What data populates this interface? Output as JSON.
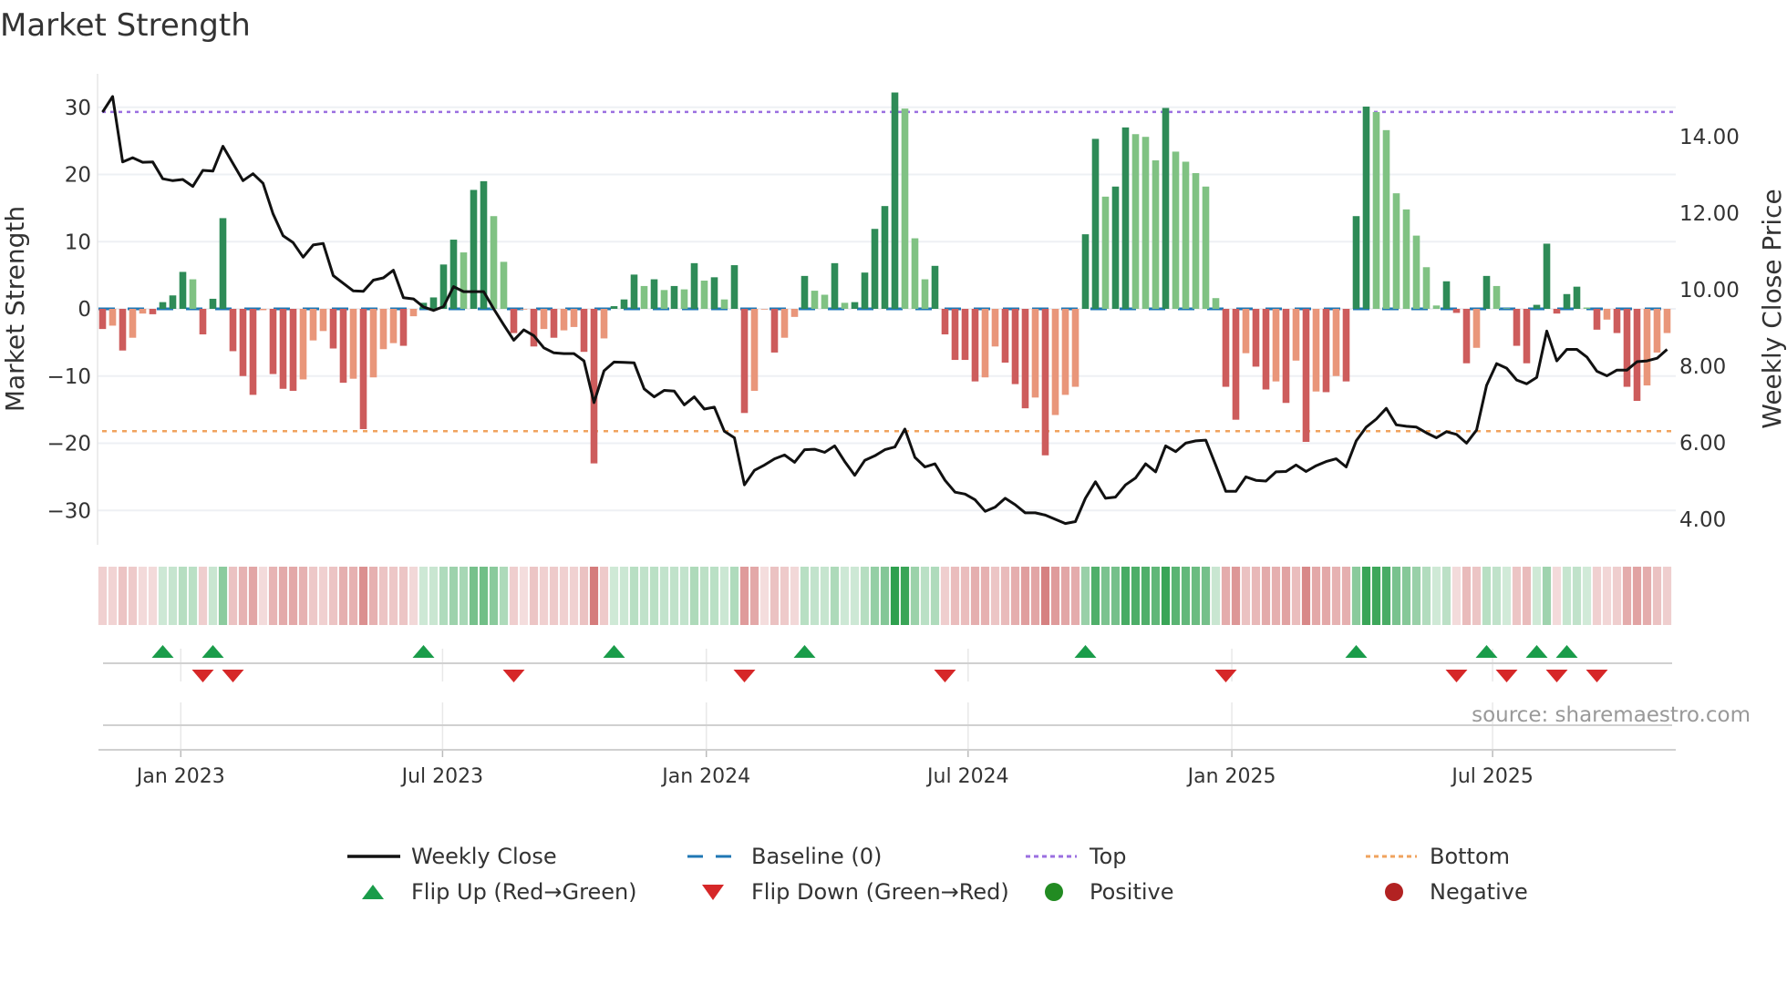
{
  "title": "Market Strength",
  "source": "source: sharemaestro.com",
  "colors": {
    "bar_pos_dark": "#2e8b57",
    "bar_pos_light": "#80c283",
    "bar_neg_dark": "#cd5c5c",
    "bar_neg_light": "#e9967a",
    "price_line": "#111111",
    "baseline": "#1f77b4",
    "top": "#9b6fe0",
    "bottom": "#f0a35e",
    "flip_up": "#1a9c4a",
    "flip_down": "#d62728",
    "positive": "#228b22",
    "negative": "#b22222"
  },
  "chart_data": {
    "type": "bar+line",
    "title": "Market Strength",
    "ylabel": "Market Strength",
    "y2label": "Weekly Close Price",
    "ylim": [
      -35,
      35
    ],
    "y2lim": [
      3.35,
      15.64
    ],
    "yticks": [
      "−30",
      "−20",
      "−10",
      "0",
      "10",
      "20",
      "30"
    ],
    "yticks_values": [
      -30,
      -20,
      -10,
      0,
      10,
      20,
      30
    ],
    "y2ticks": [
      "4.00",
      "6.00",
      "8.00",
      "10.00",
      "12.00",
      "14.00"
    ],
    "y2ticks_values": [
      4,
      6,
      8,
      10,
      12,
      14
    ],
    "x_ticks": [
      {
        "label": "Jan 2023",
        "week": 7.8
      },
      {
        "label": "Jul 2023",
        "week": 33.9
      },
      {
        "label": "Jan 2024",
        "week": 60.2
      },
      {
        "label": "Jul 2024",
        "week": 86.3
      },
      {
        "label": "Jan 2025",
        "week": 112.6
      },
      {
        "label": "Jul 2025",
        "week": 138.6
      }
    ],
    "top_level": 29.3,
    "bottom_level": -18.2,
    "strength": [
      -3,
      -2.5,
      -6.2,
      -4.3,
      -0.7,
      -0.8,
      1,
      2,
      5.5,
      4.4,
      -3.8,
      1.5,
      13.5,
      -6.3,
      -10,
      -12.8,
      -0.2,
      -9.7,
      -11.9,
      -12.2,
      -10.5,
      -4.7,
      -3.3,
      -5.9,
      -11,
      -10.4,
      -17.9,
      -10.2,
      -6,
      -5.1,
      -5.5,
      -1.1,
      0.9,
      1.7,
      6.6,
      10.3,
      8.4,
      17.7,
      19,
      13.8,
      7,
      -3.6,
      -0.1,
      -5.6,
      -3,
      -4.3,
      -3.2,
      -2.7,
      -6.4,
      -23,
      -4.4,
      0.4,
      1.4,
      5.1,
      3.4,
      4.4,
      2.8,
      3.4,
      2.9,
      6.8,
      4.2,
      4.7,
      1.4,
      6.5,
      -15.5,
      -12.2,
      -0.1,
      -6.5,
      -4.3,
      -1.2,
      4.9,
      2.7,
      2.1,
      6.8,
      0.9,
      1,
      5.4,
      11.9,
      15.3,
      32.2,
      29.8,
      10.5,
      4.4,
      6.4,
      -3.8,
      -7.6,
      -7.6,
      -10.8,
      -10.2,
      -5.6,
      -8,
      -11.2,
      -14.8,
      -13.2,
      -21.8,
      -15.8,
      -12.8,
      -11.6,
      11.1,
      25.3,
      16.7,
      18.2,
      27,
      26,
      25.6,
      22.1,
      29.9,
      23.4,
      21.9,
      20.2,
      18.2,
      1.6,
      -11.6,
      -16.5,
      -6.6,
      -8.6,
      -12,
      -10.8,
      -14,
      -7.7,
      -19.8,
      -12.3,
      -12.4,
      -10,
      -10.8,
      13.8,
      30.1,
      29.3,
      26.6,
      17.2,
      14.8,
      10.9,
      6.2,
      0.5,
      4.1,
      -0.6,
      -8.1,
      -5.8,
      4.9,
      3.4,
      0.1,
      -5.5,
      -8.1,
      0.6,
      9.7,
      -0.7,
      2.2,
      3.3,
      0.2,
      -3.1,
      -1.6,
      -3.6,
      -11.6,
      -13.7,
      -11.4,
      -6.5,
      -3.6
    ],
    "weekly_close": [
      14.64,
      15.05,
      13.34,
      13.45,
      13.33,
      13.34,
      12.9,
      12.85,
      12.88,
      12.7,
      13.12,
      13.1,
      13.75,
      13.3,
      12.85,
      13.03,
      12.78,
      11.98,
      11.41,
      11.23,
      10.85,
      11.17,
      11.21,
      10.37,
      10.17,
      9.97,
      9.96,
      10.25,
      10.31,
      10.51,
      9.79,
      9.76,
      9.55,
      9.46,
      9.56,
      10.08,
      9.95,
      9.95,
      9.95,
      9.5,
      9.08,
      8.68,
      8.95,
      8.8,
      8.48,
      8.35,
      8.33,
      8.33,
      8.14,
      7.05,
      7.88,
      8.11,
      8.1,
      8.09,
      7.41,
      7.2,
      7.37,
      7.35,
      6.99,
      7.2,
      6.88,
      6.93,
      6.3,
      6.13,
      4.9,
      5.28,
      5.42,
      5.58,
      5.68,
      5.49,
      5.82,
      5.83,
      5.75,
      5.92,
      5.51,
      5.15,
      5.54,
      5.66,
      5.82,
      5.89,
      6.36,
      5.62,
      5.37,
      5.45,
      5.02,
      4.71,
      4.66,
      4.51,
      4.21,
      4.32,
      4.55,
      4.38,
      4.17,
      4.17,
      4.11,
      4.0,
      3.89,
      3.94,
      4.55,
      4.98,
      4.55,
      4.58,
      4.9,
      5.08,
      5.45,
      5.24,
      5.92,
      5.77,
      5.99,
      6.05,
      6.07,
      5.41,
      4.73,
      4.73,
      5.11,
      5.02,
      5.0,
      5.24,
      5.25,
      5.42,
      5.25,
      5.4,
      5.51,
      5.58,
      5.37,
      6.05,
      6.41,
      6.62,
      6.9,
      6.47,
      6.43,
      6.41,
      6.26,
      6.13,
      6.29,
      6.22,
      5.99,
      6.33,
      7.5,
      8.07,
      7.95,
      7.64,
      7.54,
      7.71,
      8.92,
      8.14,
      8.44,
      8.44,
      8.24,
      7.87,
      7.75,
      7.9,
      7.9,
      8.12,
      8.14,
      8.21,
      8.44
    ],
    "flip_up_weeks": [
      6,
      11,
      32,
      51,
      70,
      98,
      125,
      138,
      143,
      146
    ],
    "flip_down_weeks": [
      10,
      13,
      41,
      64,
      84,
      112,
      135,
      140,
      145,
      149
    ]
  },
  "legend": [
    {
      "label": "Weekly Close",
      "kind": "line"
    },
    {
      "label": "Baseline (0)",
      "kind": "dash"
    },
    {
      "label": "Top",
      "kind": "dot-top"
    },
    {
      "label": "Bottom",
      "kind": "dot-bottom"
    },
    {
      "label": "Flip Up (Red→Green)",
      "kind": "up"
    },
    {
      "label": "Flip Down (Green→Red)",
      "kind": "down"
    },
    {
      "label": "Positive",
      "kind": "pos"
    },
    {
      "label": "Negative",
      "kind": "neg"
    }
  ]
}
